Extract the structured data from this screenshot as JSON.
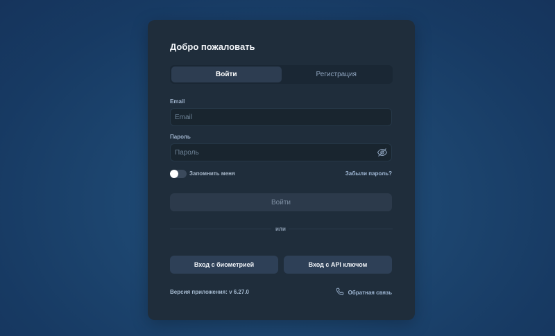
{
  "card": {
    "title": "Добро пожаловать"
  },
  "tabs": [
    {
      "label": "Войти",
      "active": true
    },
    {
      "label": "Регистрация",
      "active": false
    }
  ],
  "form": {
    "email_label": "Email",
    "email_placeholder": "Email",
    "password_label": "Пароль",
    "password_placeholder": "Пароль",
    "password_toggle_icon": "eye-off-icon",
    "remember_label": "Запомнить меня",
    "remember_checked": false,
    "forgot_link": "Забыли пароль?",
    "submit_label": "Войти"
  },
  "divider": {
    "text": "или"
  },
  "alt_login": {
    "biometric_label": "Вход с биометрией",
    "api_key_label": "Вход с API ключом"
  },
  "footer": {
    "version_text": "Версия приложения: v 6.27.0",
    "feedback_label": "Обратная связь",
    "feedback_icon": "phone-icon"
  }
}
